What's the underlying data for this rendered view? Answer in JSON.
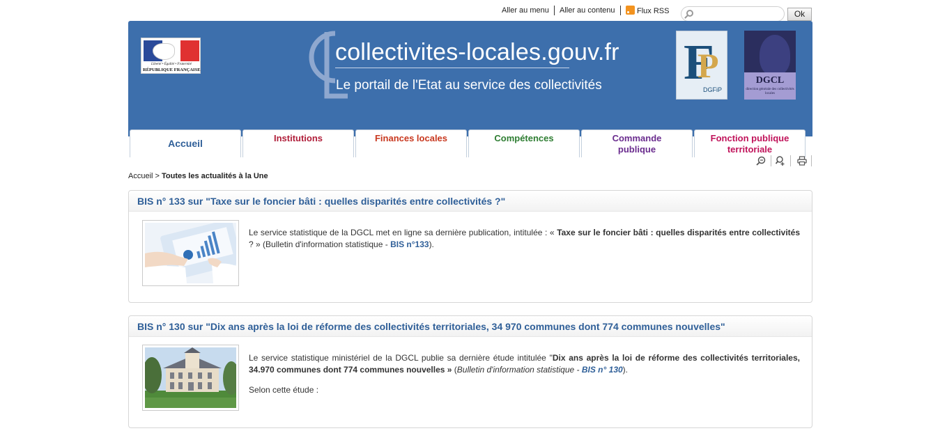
{
  "topbar": {
    "menu_link": "Aller au menu",
    "content_link": "Aller au contenu",
    "rss_link": "Flux RSS",
    "rss_icon": "rss-icon",
    "search_placeholder": "",
    "search_icon": "search-icon",
    "ok_label": "Ok"
  },
  "header": {
    "marianne_motto": "Liberté • Égalité • Fraternité",
    "marianne_republic": "RÉPUBLIQUE FRANÇAISE",
    "site_title": "collectivites-locales.gouv.fr",
    "site_subtitle": "Le portail de l'Etat au service des collectivités",
    "dgfip_label": "DGFiP",
    "dgcl_label": "DGCL",
    "dgcl_sub": "direction générale des collectivités locales",
    "colors": {
      "header_bg": "#3d6fac"
    }
  },
  "nav": {
    "tabs": [
      {
        "label": "Accueil",
        "color": "#2f5f98"
      },
      {
        "label": "Institutions",
        "color": "#b01e3a"
      },
      {
        "label": "Finances locales",
        "color": "#c8381f"
      },
      {
        "label": "Compétences",
        "color": "#2e7d32"
      },
      {
        "label": "Commande\npublique",
        "color": "#6a2c8e"
      },
      {
        "label": "Fonction publique\nterritoriale",
        "color": "#c0135a"
      }
    ]
  },
  "tools": {
    "zoom_out_icon": "zoom-out-icon",
    "zoom_in_icon": "zoom-in-icon",
    "print_icon": "print-icon"
  },
  "breadcrumb": {
    "home": "Accueil",
    "separator": " > ",
    "current": "Toutes les actualités à la Une"
  },
  "articles": [
    {
      "title": "BIS n° 133 sur \"Taxe sur le foncier bâti : quelles disparités entre collectivités ?\"",
      "text_before": "Le service statistique de la DGCL met en ligne sa dernière publication, intitulée : « ",
      "text_bold": "Taxe sur le foncier bâti : quelles disparités entre collectivités",
      "text_mid": " ? » (Bulletin d'information statistique - ",
      "link": "BIS n°133",
      "text_after": ")."
    },
    {
      "title": "BIS n° 130 sur \"Dix ans après la loi de réforme des collectivités territoriales, 34 970 communes dont 774 communes nouvelles\"",
      "text_before": "Le service statistique ministériel de la DGCL publie sa dernière étude intitulée \"",
      "text_bold": "Dix ans après la loi de réforme des collectivités territoriales, 34.970 communes dont 774 communes nouvelles »",
      "text_mid": " (",
      "text_italic": "Bulletin d'information statistique  - ",
      "link": "BIS n° 130",
      "text_after": ").",
      "extra": "Selon cette étude :"
    }
  ]
}
